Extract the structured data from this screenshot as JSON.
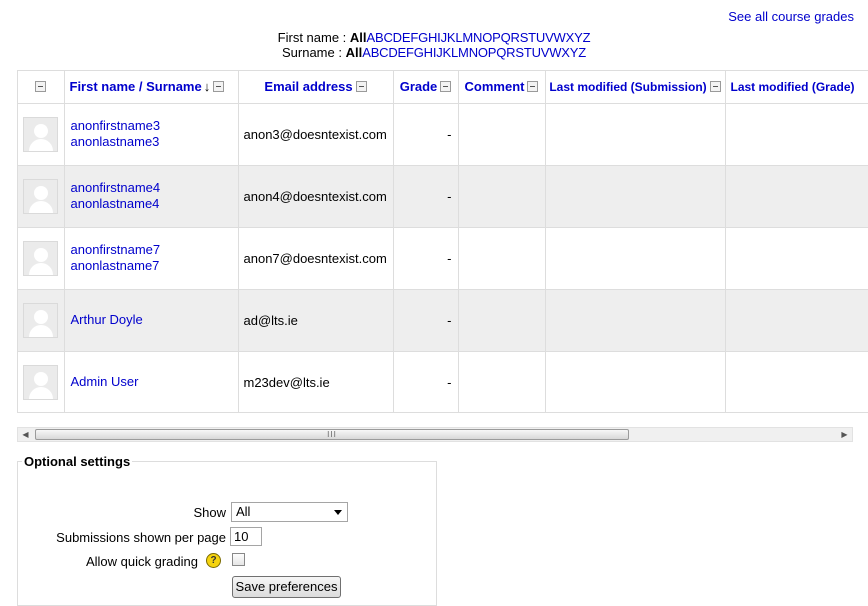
{
  "header": {
    "see_all_link": "See all course grades"
  },
  "initials_bar": {
    "first_name_label": "First name :",
    "surname_label": "Surname :",
    "all_label": "All",
    "letters": "ABCDEFGHIJKLMNOPQRSTUVWXYZ"
  },
  "table": {
    "columns": [
      {
        "label": "",
        "key": "select"
      },
      {
        "label": "First name / Surname",
        "key": "name"
      },
      {
        "label": "Email address",
        "key": "email"
      },
      {
        "label": "Grade",
        "key": "grade"
      },
      {
        "label": "Comment",
        "key": "comment"
      },
      {
        "label": "Last modified (Submission)",
        "key": "lm_sub"
      },
      {
        "label": "Last modified (Grade)",
        "key": "lm_grade"
      }
    ],
    "rows": [
      {
        "first": "anonfirstname3",
        "last": "anonlastname3",
        "email": "anon3@doesntexist.com",
        "grade": "-"
      },
      {
        "first": "anonfirstname4",
        "last": "anonlastname4",
        "email": "anon4@doesntexist.com",
        "grade": "-"
      },
      {
        "first": "anonfirstname7",
        "last": "anonlastname7",
        "email": "anon7@doesntexist.com",
        "grade": "-"
      },
      {
        "first": "Arthur Doyle",
        "last": "",
        "email": "ad@lts.ie",
        "grade": "-"
      },
      {
        "first": "Admin User",
        "last": "",
        "email": "m23dev@lts.ie",
        "grade": "-"
      }
    ],
    "sort_indicator": "↓"
  },
  "scrollbar": {
    "left_arrow": "◀",
    "right_arrow": "▶",
    "grip": "III"
  },
  "options": {
    "legend": "Optional settings",
    "show_label": "Show",
    "show_value": "All",
    "per_page_label": "Submissions shown per page",
    "per_page_value": "10",
    "quick_grading_label": "Allow quick grading",
    "help_symbol": "?",
    "save_button": "Save preferences"
  }
}
